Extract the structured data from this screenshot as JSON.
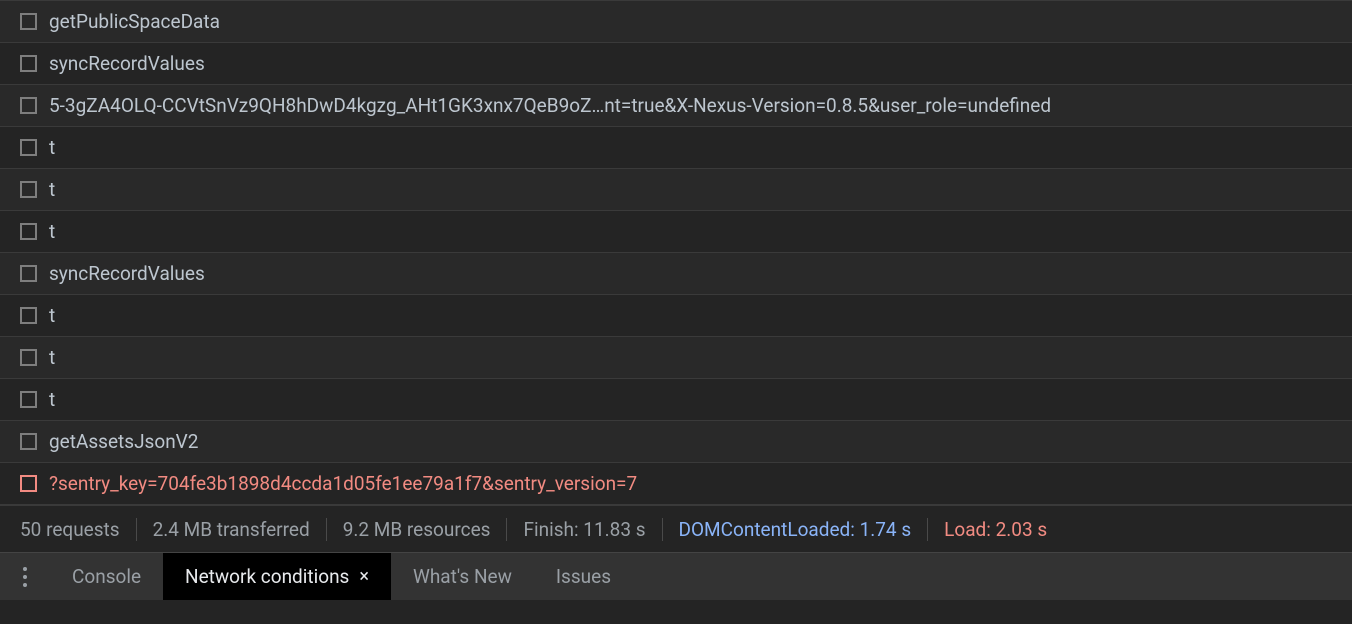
{
  "requests": [
    {
      "name": "getPublicSpaceData",
      "error": false
    },
    {
      "name": "syncRecordValues",
      "error": false
    },
    {
      "name": "5-3gZA4OLQ-CCVtSnVz9QH8hDwD4kgzg_AHt1GK3xnx7QeB9oZ…nt=true&X-Nexus-Version=0.8.5&user_role=undefined",
      "error": false
    },
    {
      "name": "t",
      "error": false
    },
    {
      "name": "t",
      "error": false
    },
    {
      "name": "t",
      "error": false
    },
    {
      "name": "syncRecordValues",
      "error": false
    },
    {
      "name": "t",
      "error": false
    },
    {
      "name": "t",
      "error": false
    },
    {
      "name": "t",
      "error": false
    },
    {
      "name": "getAssetsJsonV2",
      "error": false
    },
    {
      "name": "?sentry_key=704fe3b1898d4ccda1d05fe1ee79a1f7&sentry_version=7",
      "error": true
    }
  ],
  "status": {
    "requests": "50 requests",
    "transferred": "2.4 MB transferred",
    "resources": "9.2 MB resources",
    "finish": "Finish: 11.83 s",
    "dcl": "DOMContentLoaded: 1.74 s",
    "load": "Load: 2.03 s"
  },
  "tabs": {
    "console": "Console",
    "network_conditions": "Network conditions",
    "close_glyph": "×",
    "whats_new": "What's New",
    "issues": "Issues"
  }
}
